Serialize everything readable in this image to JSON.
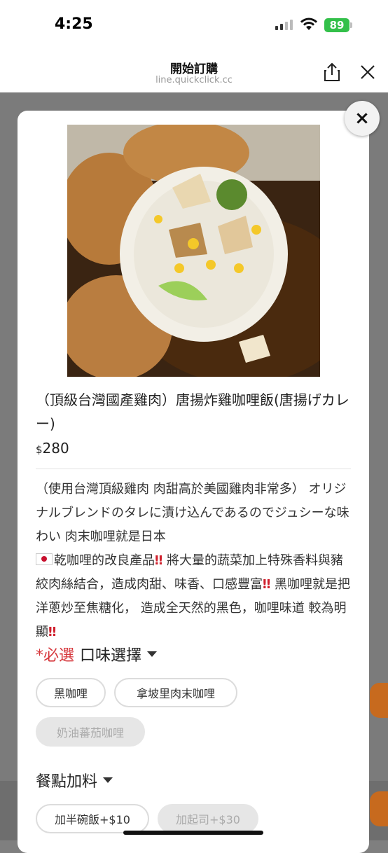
{
  "status_bar": {
    "time": "4:25",
    "battery": "89"
  },
  "browser": {
    "title": "開始訂購",
    "url": "line.quickclick.cc"
  },
  "item": {
    "title": "（頂級台灣國產雞肉）唐揚炸雞咖哩飯(唐揚げカレー)",
    "price_currency": "$",
    "price_value": "280",
    "description": {
      "p1": "（使用台灣頂級雞肉 肉甜高於美國雞肉非常多） オリジナルブレンドのタレに漬け込んであるのでジュシーな味わい 肉末咖哩就是日本",
      "p2": "乾咖哩的改良產品",
      "p3": " 將大量的蔬菜加上特殊香料與豬絞肉絲結合，造成肉甜、味香、口感豐富",
      "p4": " 黑咖哩就是把洋蔥炒至焦糖化， 造成全天然的黑色，咖哩味道 較為明顯",
      "bang": "‼"
    }
  },
  "flavor_section": {
    "required_label": "*必選",
    "title": "口味選擇",
    "options": [
      {
        "label": "黑咖哩",
        "disabled": false
      },
      {
        "label": "拿坡里肉末咖哩",
        "disabled": false
      },
      {
        "label": "奶油蕃茄咖哩",
        "disabled": true
      }
    ]
  },
  "addon_section": {
    "title": "餐點加料",
    "options": [
      {
        "label": "加半碗飯+$10",
        "disabled": false
      },
      {
        "label": "加起司+$30",
        "disabled": true
      }
    ]
  },
  "modal_close": "×"
}
